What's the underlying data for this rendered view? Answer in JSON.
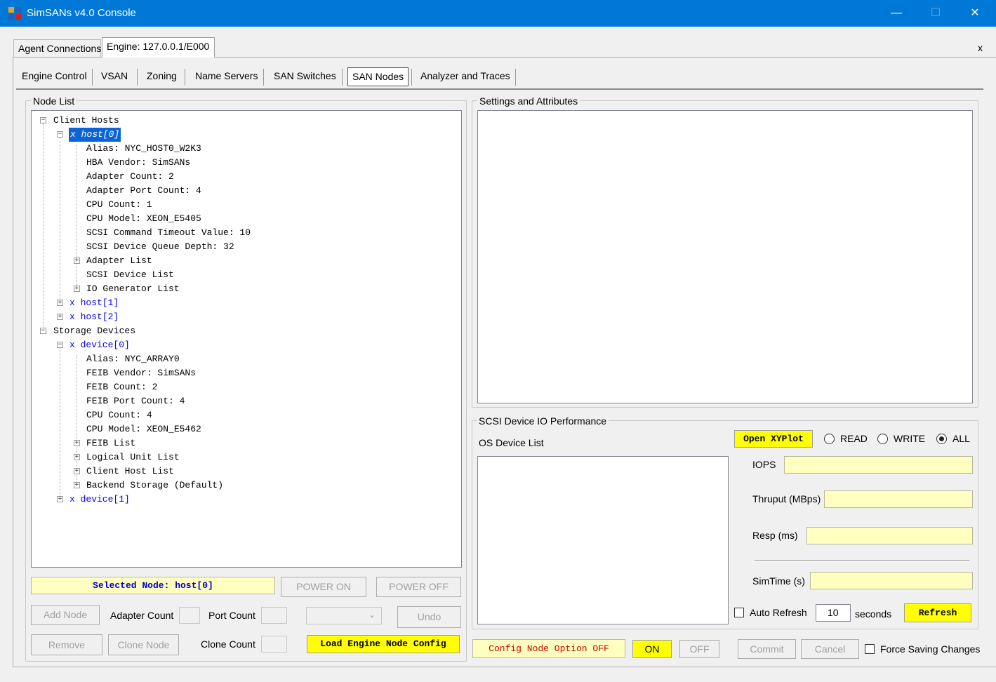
{
  "window": {
    "title": "SimSANs v4.0 Console",
    "minimize": "—",
    "maximize": "☐",
    "close": "✕"
  },
  "outer_tabs": [
    {
      "label": "Agent Connections"
    },
    {
      "label": "Engine: 127.0.0.1/E000"
    }
  ],
  "outer_close": "x",
  "inner_tabs": [
    {
      "label": "Engine Control"
    },
    {
      "label": "VSAN"
    },
    {
      "label": "Zoning"
    },
    {
      "label": "Name Servers"
    },
    {
      "label": "SAN Switches"
    },
    {
      "label": "SAN Nodes"
    },
    {
      "label": "Analyzer and Traces"
    }
  ],
  "node_list": {
    "label": "Node List",
    "tree": [
      "Client Hosts",
      "x host[0]",
      "Alias: NYC_HOST0_W2K3",
      "HBA Vendor: SimSANs",
      "Adapter Count: 2",
      "Adapter Port Count: 4",
      "CPU Count: 1",
      "CPU Model: XEON_E5405",
      "SCSI Command Timeout Value: 10",
      "SCSI Device Queue Depth: 32",
      "Adapter List",
      "SCSI Device List",
      "IO Generator List",
      "x host[1]",
      "x host[2]",
      "Storage Devices",
      "x device[0]",
      "Alias: NYC_ARRAY0",
      "FEIB Vendor: SimSANs",
      "FEIB Count: 2",
      "FEIB Port Count: 4",
      "CPU Count: 4",
      "CPU Model: XEON_E5462",
      "FEIB List",
      "Logical Unit List",
      "Client Host List",
      "Backend Storage (Default)",
      "x device[1]"
    ],
    "selected_node": "Selected Node: host[0]",
    "power_on": "POWER ON",
    "power_off": "POWER OFF",
    "add_node": "Add Node",
    "adapter_count_label": "Adapter Count",
    "port_count_label": "Port Count",
    "undo": "Undo",
    "remove": "Remove",
    "clone_node": "Clone Node",
    "clone_count_label": "Clone Count",
    "load_config": "Load Engine Node Config"
  },
  "settings": {
    "label": "Settings and Attributes"
  },
  "perf": {
    "label": "SCSI Device IO Performance",
    "os_device_list": "OS Device List",
    "open_xyplot": "Open XYPlot",
    "read": "READ",
    "write": "WRITE",
    "all": "ALL",
    "iops": "IOPS",
    "thruput": "Thruput (MBps)",
    "resp": "Resp (ms)",
    "simtime": "SimTime (s)",
    "auto_refresh": "Auto Refresh",
    "refresh_interval": "10",
    "seconds": "seconds",
    "refresh": "Refresh"
  },
  "bottom": {
    "config_option": "Config Node Option OFF",
    "on": "ON",
    "off": "OFF",
    "commit": "Commit",
    "cancel": "Cancel",
    "force_saving": "Force Saving Changes"
  },
  "colors": {
    "titlebar": "#0078d7",
    "highlight": "#ffff00",
    "field_yellow": "#ffffc0",
    "selection": "#0a64d8",
    "link": "#0000ee"
  }
}
